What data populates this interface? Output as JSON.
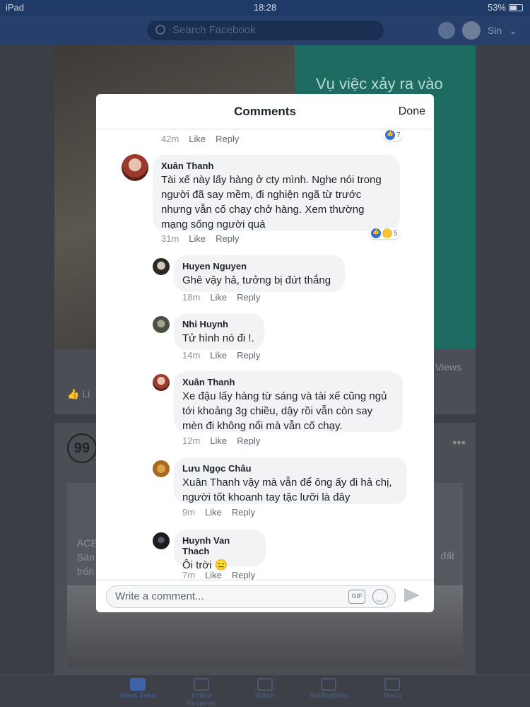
{
  "status": {
    "device": "iPad",
    "time": "18:28",
    "battery": "53%"
  },
  "fb": {
    "search_placeholder": "Search Facebook",
    "user": "Sin"
  },
  "feed": {
    "post1_text": "Vụ việc xảy ra vào",
    "views": "Views",
    "like_partial": "Li",
    "post2_logo": "99",
    "post2_text": "ACE\nSán\ntrốn",
    "post2_right": "đất"
  },
  "tabbar": [
    "News Feed",
    "Friend Requests",
    "Watch",
    "Notifications",
    "Menu"
  ],
  "modal": {
    "title": "Comments",
    "done": "Done",
    "prev_meta": {
      "time": "42m",
      "like": "Like",
      "reply": "Reply",
      "reactions": "7"
    },
    "comments": [
      {
        "name": "Xuân Thanh",
        "text": "Tài xế này lấy hàng ở cty mình. Nghe nói trong người đã say mềm, đi nghiện ngã từ trước nhưng vẫn cố chạy chở hàng. Xem thường mạng sống người quá",
        "time": "31m",
        "like": "Like",
        "reply": "Reply",
        "reactions": "5"
      },
      {
        "name": "Huyen Nguyen",
        "text": "Ghê vậy hả, tưởng bị đứt thắng",
        "time": "18m",
        "like": "Like",
        "reply": "Reply"
      },
      {
        "name": "Nhi Huynh",
        "text": "Tử hình nó đi !.",
        "time": "14m",
        "like": "Like",
        "reply": "Reply"
      },
      {
        "name": "Xuân Thanh",
        "text": "Xe đậu lấy hàng từ sáng và tài xế cũng ngủ tới khoảng 3g chiều, dậy rồi vẫn còn say mèn đi không nổi mà vẫn cố chạy.",
        "time": "12m",
        "like": "Like",
        "reply": "Reply"
      },
      {
        "name": "Lưu Ngọc Châu",
        "text": "Xuân Thanh vậy mà vẫn để ông ấy đi hả chị, người tốt khoanh tay tặc lưỡi là đây",
        "time": "9m",
        "like": "Like",
        "reply": "Reply"
      },
      {
        "name": "Huynh Van Thach",
        "text": "Ôi trời 😑",
        "time": "7m",
        "like": "Like",
        "reply": "Reply"
      }
    ],
    "composer_placeholder": "Write a comment...",
    "gif_label": "GIF"
  },
  "colors": {
    "accent": "#2d72d9",
    "bubble": "#f2f3f5",
    "fbblue": "#26406b"
  }
}
